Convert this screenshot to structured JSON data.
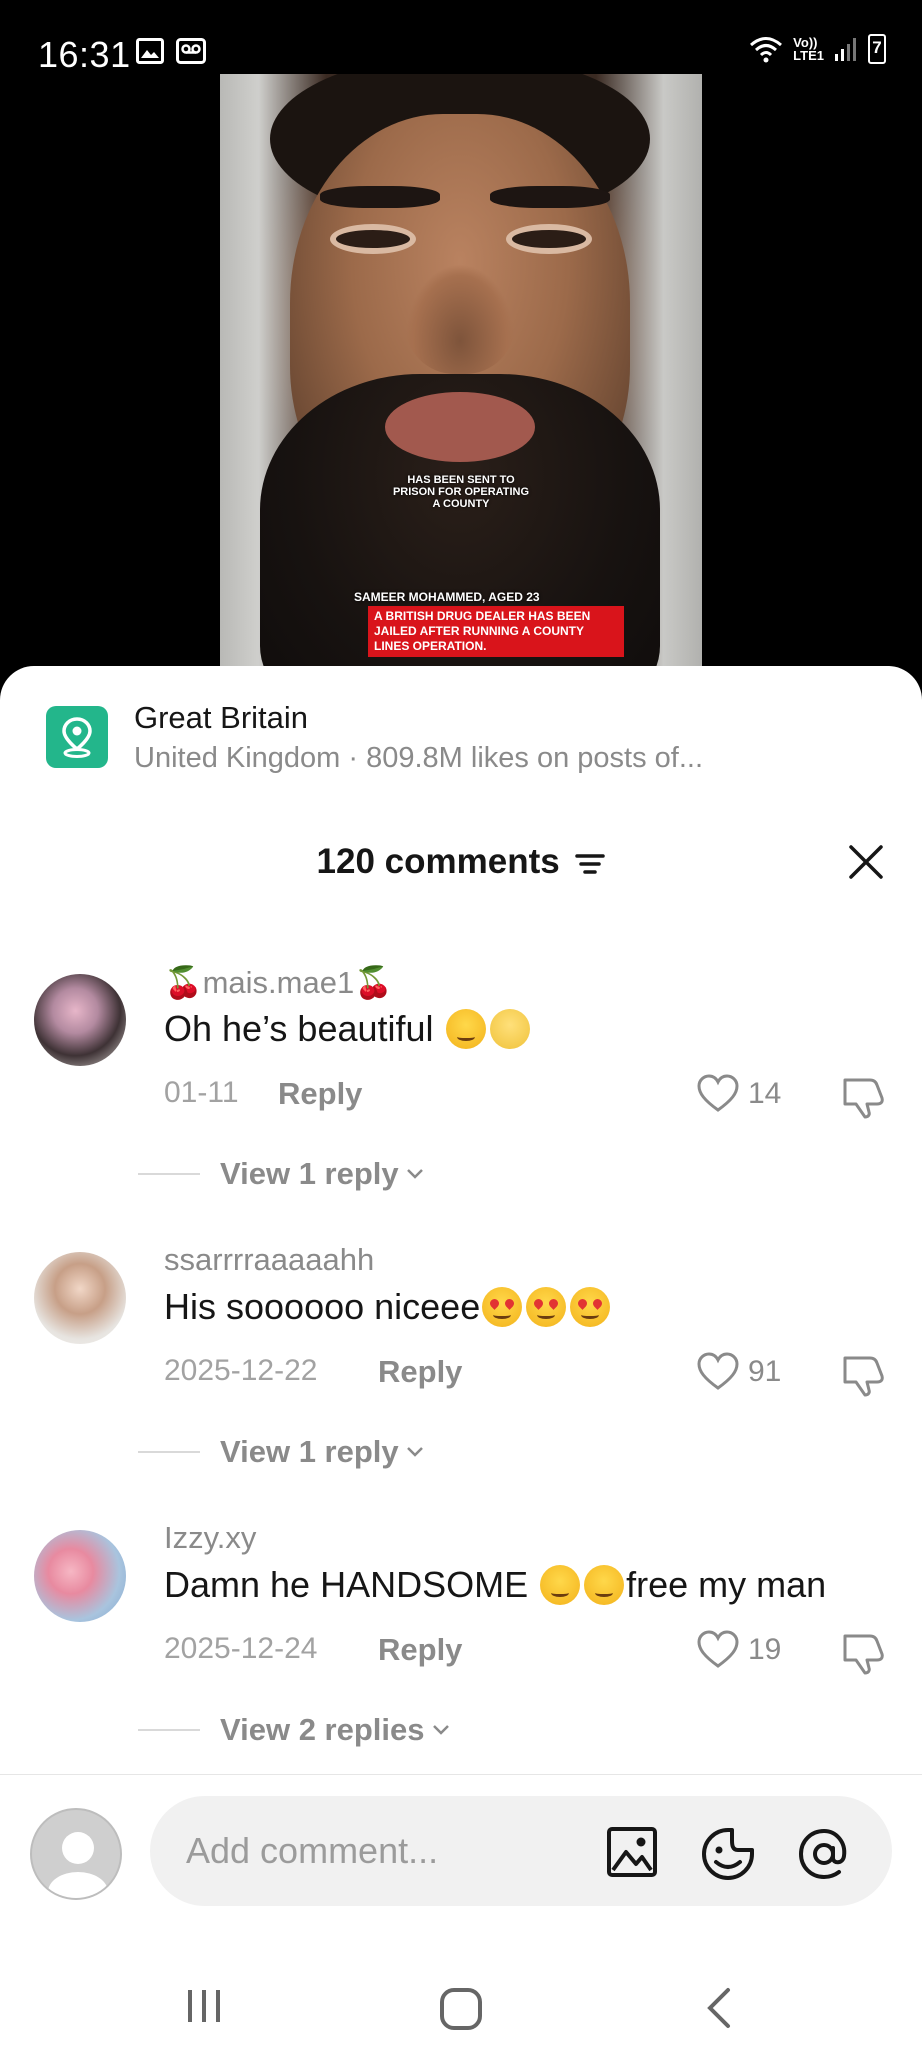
{
  "status_bar": {
    "time": "16:31",
    "network_label_top": "Vo))",
    "network_label_bottom": "LTE1",
    "battery_level": "7"
  },
  "video": {
    "caption_center": "HAS BEEN SENT TO PRISON FOR OPERATING A COUNTY",
    "caption_name": "SAMEER MOHAMMED, AGED 23",
    "caption_banner": "A BRITISH DRUG DEALER HAS BEEN JAILED AFTER RUNNING A COUNTY LINES OPERATION."
  },
  "location": {
    "title": "Great Britain",
    "subtitle": "United Kingdom · 809.8M likes on posts of..."
  },
  "comments_header": {
    "title": "120 comments"
  },
  "comments": [
    {
      "username": "mais.mae1",
      "text": "Oh he’s beautiful",
      "date": "01-11",
      "reply_label": "Reply",
      "likes": "14",
      "view_replies": "View 1 reply"
    },
    {
      "username": "ssarrrraaaaahh",
      "text": "His soooooo niceee",
      "date": "2025-12-22",
      "reply_label": "Reply",
      "likes": "91",
      "view_replies": "View 1 reply"
    },
    {
      "username": "Izzy.xy",
      "text_before": "Damn he HANDSOME ",
      "text_after": "free my man",
      "date": "2025-12-24",
      "reply_label": "Reply",
      "likes": "19",
      "view_replies": "View 2 replies"
    }
  ],
  "composer": {
    "placeholder": "Add comment..."
  },
  "colors": {
    "location_badge": "#23b68b",
    "banner_red": "#d9141b"
  }
}
